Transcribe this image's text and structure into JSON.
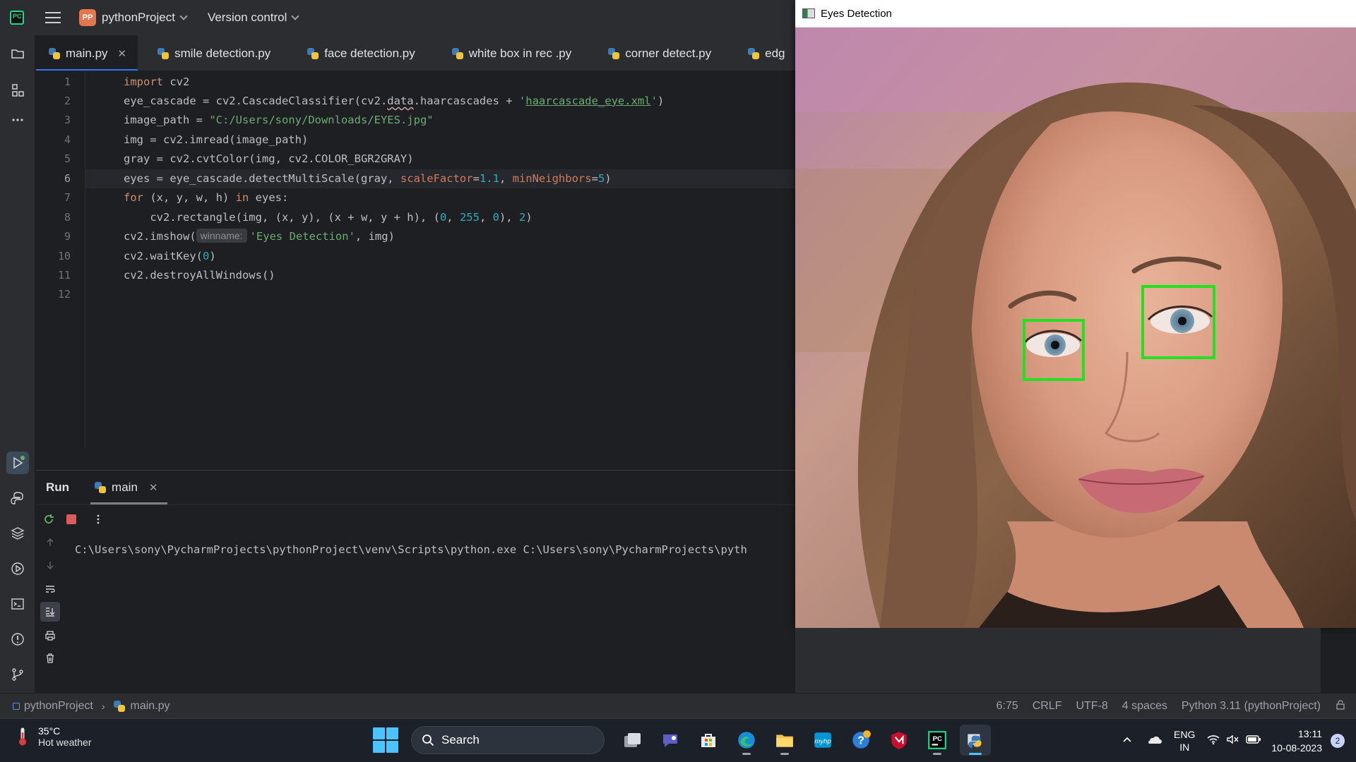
{
  "titlebar": {
    "project_badge": "PP",
    "project_name": "pythonProject",
    "vcs_label": "Version control"
  },
  "tabs": [
    {
      "label": "main.py",
      "active": true
    },
    {
      "label": "smile detection.py"
    },
    {
      "label": "face detection.py"
    },
    {
      "label": "white box in rec .py"
    },
    {
      "label": "corner detect.py"
    },
    {
      "label": "edg"
    }
  ],
  "editor": {
    "line_numbers": [
      "1",
      "2",
      "3",
      "4",
      "5",
      "6",
      "7",
      "8",
      "9",
      "10",
      "11",
      "12"
    ],
    "current_line": 6,
    "lines": [
      "import cv2",
      "eye_cascade = cv2.CascadeClassifier(cv2.data.haarcascades + 'haarcascade_eye.xml')",
      "image_path = \"C:/Users/sony/Downloads/EYES.jpg\"",
      "img = cv2.imread(image_path)",
      "gray = cv2.cvtColor(img, cv2.COLOR_BGR2GRAY)",
      "eyes = eye_cascade.detectMultiScale(gray, scaleFactor=1.1, minNeighbors=5)",
      "for (x, y, w, h) in eyes:",
      "    cv2.rectangle(img, (x, y), (x + w, y + h), (0, 255, 0), 2)",
      "cv2.imshow(winname: 'Eyes Detection', img)",
      "cv2.waitKey(0)",
      "cv2.destroyAllWindows()",
      ""
    ],
    "inlay_hint": "winname:"
  },
  "run_panel": {
    "title": "Run",
    "tab_label": "main",
    "console_text": "C:\\Users\\sony\\PycharmProjects\\pythonProject\\venv\\Scripts\\python.exe C:\\Users\\sony\\PycharmProjects\\pyth"
  },
  "statusbar": {
    "project": "pythonProject",
    "file": "main.py",
    "position": "6:75",
    "line_sep": "CRLF",
    "encoding": "UTF-8",
    "indent": "4 spaces",
    "interpreter": "Python 3.11 (pythonProject)"
  },
  "cv_window": {
    "title": "Eyes Detection",
    "rect_color": "#22e022"
  },
  "taskbar": {
    "weather_temp": "35°C",
    "weather_desc": "Hot weather",
    "search_label": "Search",
    "lang_line1": "ENG",
    "lang_line2": "IN",
    "time": "13:11",
    "date": "10-08-2023",
    "notification_count": "2"
  },
  "colors": {
    "accent": "#3574f0",
    "keyword": "#cf8e6d",
    "string": "#6aab73",
    "number": "#2aacb8",
    "param": "#ce7d5a"
  }
}
